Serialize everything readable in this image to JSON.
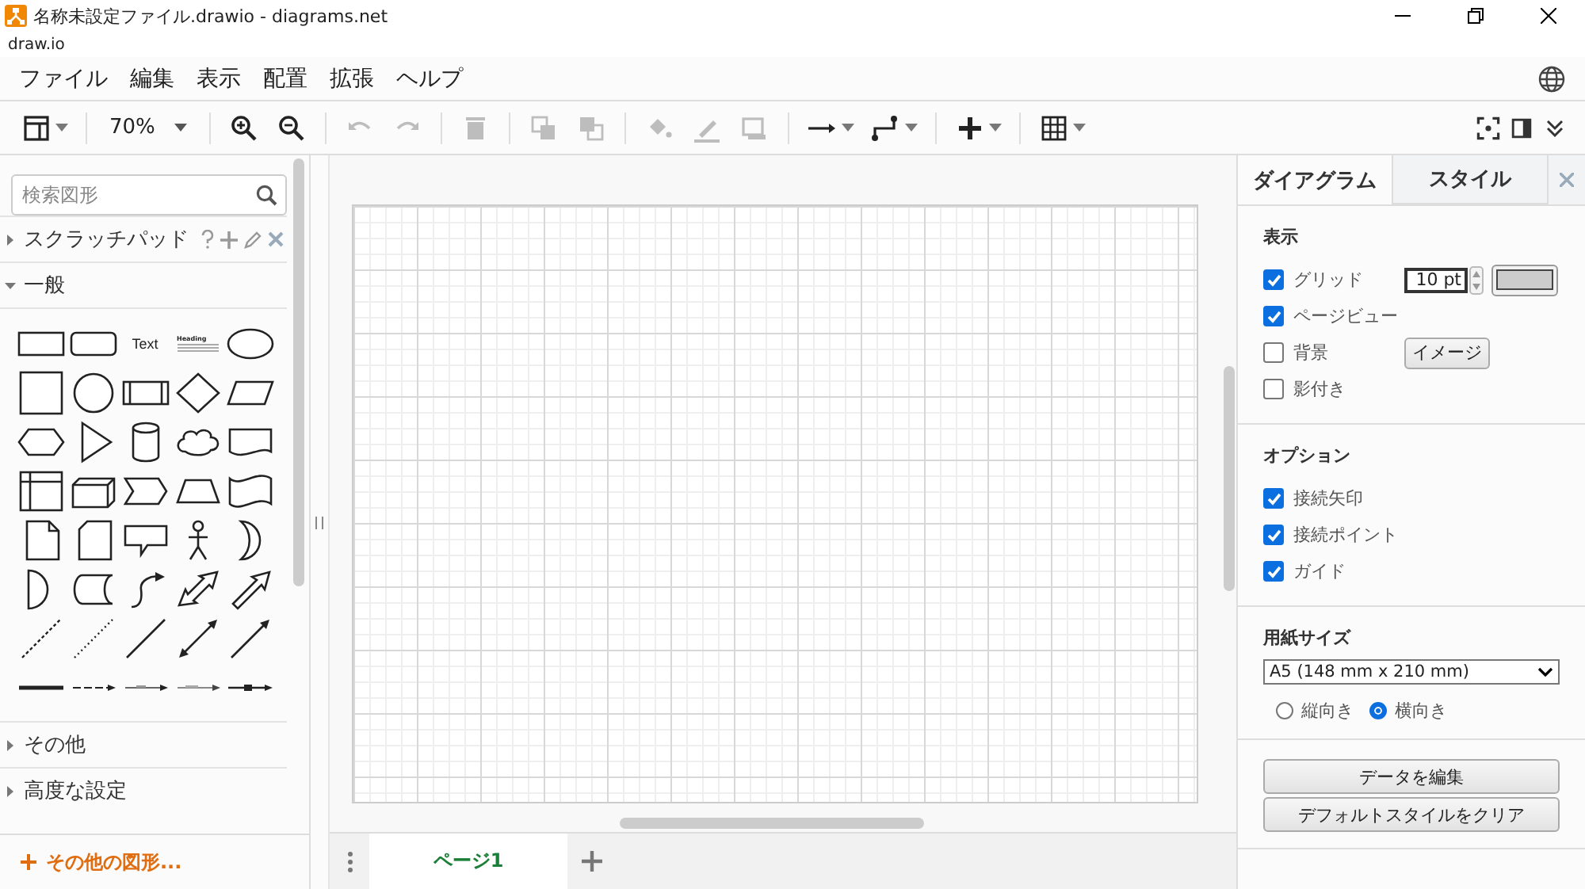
{
  "window": {
    "title": "名称未設定ファイル.drawio - diagrams.net",
    "app_name": "draw.io"
  },
  "menu": [
    {
      "label": "ファイル"
    },
    {
      "label": "編集"
    },
    {
      "label": "表示"
    },
    {
      "label": "配置"
    },
    {
      "label": "拡張"
    },
    {
      "label": "ヘルプ"
    }
  ],
  "toolbar": {
    "zoom": "70%",
    "tools": [
      {
        "kind": "panels",
        "disabled": false
      },
      {
        "kind": "zoom",
        "disabled": false
      },
      {
        "kind": "zoom-in",
        "disabled": false
      },
      {
        "kind": "zoom-out",
        "disabled": false
      },
      {
        "kind": "undo",
        "disabled": true
      },
      {
        "kind": "redo",
        "disabled": true
      },
      {
        "kind": "delete",
        "disabled": true
      },
      {
        "kind": "to-front",
        "disabled": true
      },
      {
        "kind": "to-back",
        "disabled": true
      },
      {
        "kind": "fill",
        "disabled": true
      },
      {
        "kind": "line-color",
        "disabled": true
      },
      {
        "kind": "shadow",
        "disabled": true
      },
      {
        "kind": "connection",
        "disabled": false
      },
      {
        "kind": "waypoints",
        "disabled": false
      },
      {
        "kind": "insert",
        "disabled": false
      },
      {
        "kind": "table",
        "disabled": false
      }
    ],
    "right_tools": [
      {
        "kind": "fullscreen"
      },
      {
        "kind": "format-panel"
      },
      {
        "kind": "collapse"
      }
    ]
  },
  "sidebar": {
    "search": {
      "placeholder": "検索図形"
    },
    "sections": [
      {
        "title": "スクラッチパッド",
        "kind": "scratchpad",
        "expanded": false
      },
      {
        "title": "一般",
        "kind": "shapes",
        "expanded": true
      },
      {
        "title": "その他",
        "kind": "plain",
        "expanded": false
      },
      {
        "title": "高度な設定",
        "kind": "plain",
        "expanded": false
      }
    ],
    "shapes": [
      {
        "kind": "rectangle"
      },
      {
        "kind": "rounded-rectangle"
      },
      {
        "kind": "text",
        "label": "Text"
      },
      {
        "kind": "textbox",
        "label": "Heading"
      },
      {
        "kind": "ellipse"
      },
      {
        "kind": "square"
      },
      {
        "kind": "circle"
      },
      {
        "kind": "process"
      },
      {
        "kind": "diamond"
      },
      {
        "kind": "parallelogram"
      },
      {
        "kind": "hexagon"
      },
      {
        "kind": "triangle"
      },
      {
        "kind": "cylinder"
      },
      {
        "kind": "cloud"
      },
      {
        "kind": "document"
      },
      {
        "kind": "internal-storage"
      },
      {
        "kind": "cube"
      },
      {
        "kind": "step"
      },
      {
        "kind": "trapezoid"
      },
      {
        "kind": "tape"
      },
      {
        "kind": "note"
      },
      {
        "kind": "card"
      },
      {
        "kind": "callout"
      },
      {
        "kind": "actor"
      },
      {
        "kind": "crescent"
      },
      {
        "kind": "half-circle"
      },
      {
        "kind": "data-storage"
      },
      {
        "kind": "curved-arrow"
      },
      {
        "kind": "double-arrow"
      },
      {
        "kind": "arrow"
      },
      {
        "kind": "dashed-line"
      },
      {
        "kind": "dotted-line"
      },
      {
        "kind": "line"
      },
      {
        "kind": "bidirectional-line"
      },
      {
        "kind": "directional-line"
      },
      {
        "kind": "thick-line"
      },
      {
        "kind": "dashed-arrow"
      },
      {
        "kind": "labeled-arrow"
      },
      {
        "kind": "labeled-arrow-2"
      },
      {
        "kind": "box-connector"
      }
    ],
    "more_shapes": "その他の図形..."
  },
  "format_panel": {
    "tabs": [
      {
        "label": "ダイアグラム",
        "selected": true
      },
      {
        "label": "スタイル",
        "selected": false
      }
    ],
    "sections": [
      {
        "title": "表示",
        "rows": [
          {
            "label": "グリッド",
            "checked": true,
            "value": "10 pt"
          },
          {
            "label": "ページビュー",
            "checked": true
          },
          {
            "label": "背景",
            "checked": false,
            "button": "イメージ"
          },
          {
            "label": "影付き",
            "checked": false
          }
        ]
      },
      {
        "title": "オプション",
        "rows": [
          {
            "label": "接続矢印",
            "checked": true
          },
          {
            "label": "接続ポイント",
            "checked": true
          },
          {
            "label": "ガイド",
            "checked": true
          }
        ]
      }
    ],
    "paper": {
      "title": "用紙サイズ",
      "size": "A5 (148 mm x 210 mm)",
      "orientations": [
        {
          "label": "縦向き",
          "selected": false
        },
        {
          "label": "横向き",
          "selected": true
        }
      ]
    },
    "buttons": [
      {
        "label": "データを編集"
      },
      {
        "label": "デフォルトスタイルをクリア"
      }
    ]
  },
  "pages": {
    "tabs": [
      {
        "label": "ページ1",
        "selected": true
      }
    ]
  }
}
